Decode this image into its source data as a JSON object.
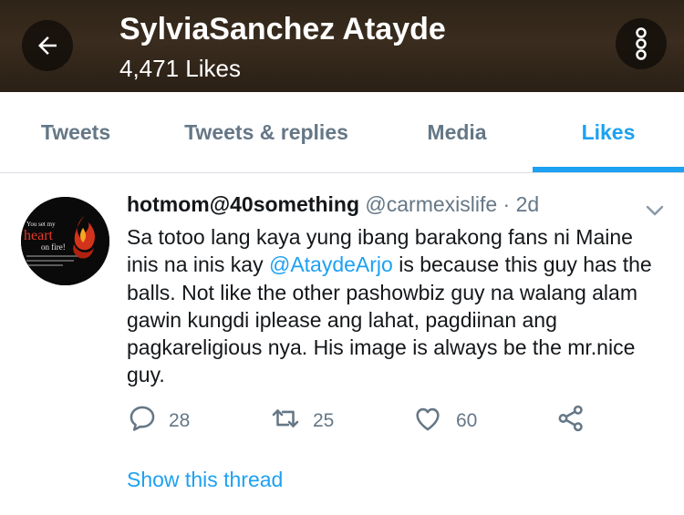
{
  "header": {
    "profile_name": "SylviaSanchez Atayde",
    "likes_count": "4,471 Likes",
    "back_icon": "arrow-left-icon",
    "menu_icon": "more-vertical-icon"
  },
  "tabs": [
    {
      "label": "Tweets",
      "active": false
    },
    {
      "label": "Tweets & replies",
      "active": false
    },
    {
      "label": "Media",
      "active": false
    },
    {
      "label": "Likes",
      "active": true
    }
  ],
  "tweet": {
    "author_name": "hotmom@40something",
    "author_handle": "@carmexislife",
    "separator": "·",
    "time": "2d",
    "body_before_mention": "Sa totoo lang kaya yung ibang barakong fans ni Maine inis na inis kay ",
    "mention": "@AtaydeArjo",
    "body_after_mention": " is because this guy has the balls. Not like the other pashowbiz guy na walang alam gawin kungdi iplease ang lahat, pagdiinan ang pagkareligious nya. His image is always be the mr.nice guy.",
    "avatar": {
      "line1": "You set my",
      "line2": "heart",
      "line3": "on fire!"
    },
    "actions": {
      "replies": "28",
      "retweets": "25",
      "likes": "60"
    },
    "show_thread": "Show this thread"
  },
  "colors": {
    "accent": "#1da1f2",
    "secondary_text": "#657786",
    "header_bg": "#2e2418"
  }
}
